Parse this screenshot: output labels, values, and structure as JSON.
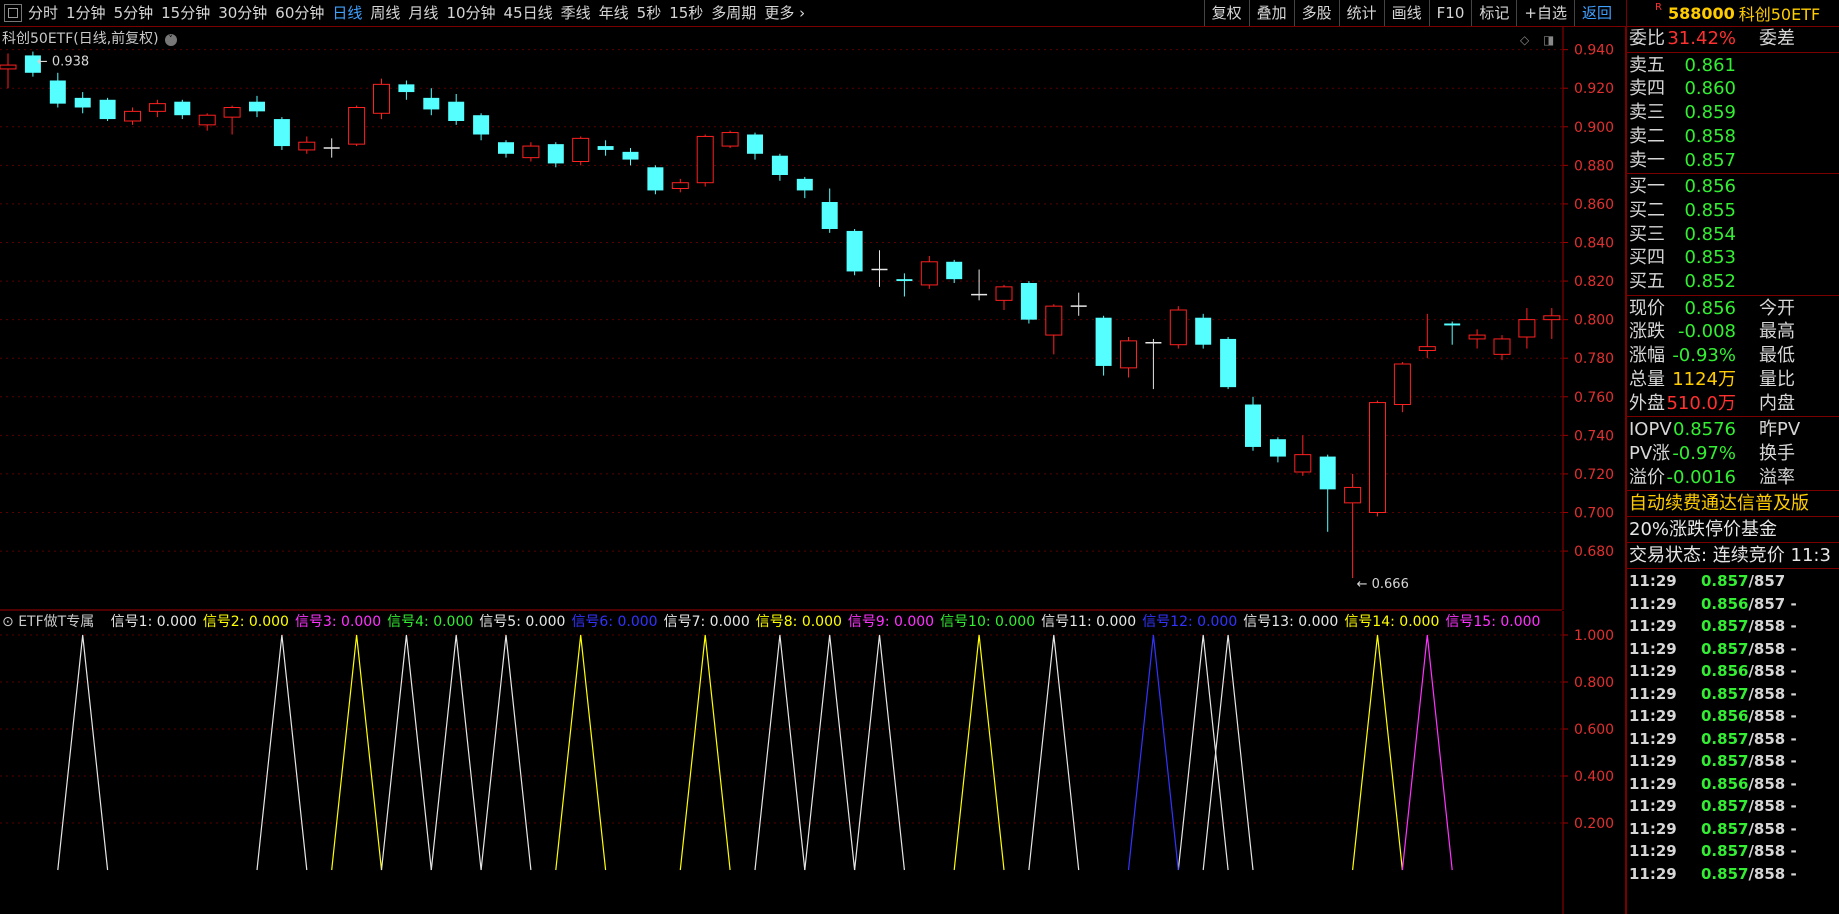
{
  "toolbar": {
    "periods": [
      "分时",
      "1分钟",
      "5分钟",
      "15分钟",
      "30分钟",
      "60分钟",
      "日线",
      "周线",
      "月线",
      "10分钟",
      "45日线",
      "季线",
      "年线",
      "5秒",
      "15秒",
      "多周期",
      "更多 ›"
    ],
    "active_period": "日线",
    "right_buttons": [
      "复权",
      "叠加",
      "多股",
      "统计",
      "画线",
      "F10",
      "标记",
      "+自选",
      "返回"
    ]
  },
  "stock": {
    "marker": "R",
    "code": "588000",
    "name": "科创50ETF"
  },
  "chart": {
    "title": "科创50ETF(日线,前复权)",
    "high_label": "0.938",
    "low_label": "0.666",
    "price_ticks": [
      "0.940",
      "0.920",
      "0.900",
      "0.880",
      "0.860",
      "0.840",
      "0.820",
      "0.800",
      "0.780",
      "0.760",
      "0.740",
      "0.720",
      "0.700",
      "0.680"
    ],
    "indicator_ticks": [
      "1.000",
      "0.800",
      "0.600",
      "0.400",
      "0.200"
    ]
  },
  "chart_data": {
    "type": "candlestick",
    "ylim": [
      0.665,
      0.945
    ],
    "candles": [
      [
        0.93,
        0.932,
        0.92,
        0.938
      ],
      [
        0.937,
        0.928,
        0.926,
        0.939
      ],
      [
        0.924,
        0.912,
        0.91,
        0.928
      ],
      [
        0.915,
        0.91,
        0.907,
        0.918
      ],
      [
        0.914,
        0.904,
        0.903,
        0.915
      ],
      [
        0.903,
        0.908,
        0.901,
        0.91
      ],
      [
        0.908,
        0.912,
        0.905,
        0.914
      ],
      [
        0.913,
        0.906,
        0.904,
        0.914
      ],
      [
        0.901,
        0.906,
        0.898,
        0.907
      ],
      [
        0.905,
        0.91,
        0.896,
        0.911
      ],
      [
        0.913,
        0.908,
        0.905,
        0.916
      ],
      [
        0.904,
        0.89,
        0.888,
        0.905
      ],
      [
        0.888,
        0.892,
        0.886,
        0.895
      ],
      [
        0.889,
        0.889,
        0.884,
        0.894
      ],
      [
        0.891,
        0.91,
        0.89,
        0.911
      ],
      [
        0.907,
        0.922,
        0.904,
        0.925
      ],
      [
        0.922,
        0.918,
        0.914,
        0.924
      ],
      [
        0.915,
        0.909,
        0.906,
        0.92
      ],
      [
        0.913,
        0.903,
        0.901,
        0.917
      ],
      [
        0.906,
        0.896,
        0.893,
        0.907
      ],
      [
        0.892,
        0.886,
        0.884,
        0.893
      ],
      [
        0.884,
        0.89,
        0.882,
        0.892
      ],
      [
        0.891,
        0.881,
        0.879,
        0.892
      ],
      [
        0.882,
        0.894,
        0.88,
        0.895
      ],
      [
        0.89,
        0.888,
        0.885,
        0.893
      ],
      [
        0.887,
        0.883,
        0.88,
        0.889
      ],
      [
        0.879,
        0.867,
        0.865,
        0.88
      ],
      [
        0.868,
        0.871,
        0.866,
        0.873
      ],
      [
        0.871,
        0.895,
        0.869,
        0.896
      ],
      [
        0.89,
        0.897,
        0.889,
        0.898
      ],
      [
        0.896,
        0.886,
        0.883,
        0.897
      ],
      [
        0.885,
        0.875,
        0.872,
        0.886
      ],
      [
        0.873,
        0.867,
        0.863,
        0.874
      ],
      [
        0.861,
        0.847,
        0.845,
        0.868
      ],
      [
        0.846,
        0.825,
        0.823,
        0.847
      ],
      [
        0.826,
        0.826,
        0.817,
        0.836
      ],
      [
        0.821,
        0.82,
        0.812,
        0.824
      ],
      [
        0.818,
        0.83,
        0.816,
        0.833
      ],
      [
        0.83,
        0.821,
        0.819,
        0.831
      ],
      [
        0.813,
        0.813,
        0.81,
        0.826
      ],
      [
        0.81,
        0.817,
        0.805,
        0.818
      ],
      [
        0.819,
        0.8,
        0.798,
        0.82
      ],
      [
        0.792,
        0.807,
        0.782,
        0.808
      ],
      [
        0.807,
        0.807,
        0.802,
        0.814
      ],
      [
        0.801,
        0.776,
        0.771,
        0.802
      ],
      [
        0.775,
        0.789,
        0.77,
        0.791
      ],
      [
        0.788,
        0.788,
        0.764,
        0.79
      ],
      [
        0.787,
        0.805,
        0.785,
        0.807
      ],
      [
        0.801,
        0.787,
        0.785,
        0.803
      ],
      [
        0.79,
        0.765,
        0.764,
        0.791
      ],
      [
        0.756,
        0.734,
        0.732,
        0.76
      ],
      [
        0.738,
        0.729,
        0.726,
        0.739
      ],
      [
        0.721,
        0.73,
        0.719,
        0.74
      ],
      [
        0.729,
        0.712,
        0.69,
        0.73
      ],
      [
        0.705,
        0.713,
        0.666,
        0.72
      ],
      [
        0.7,
        0.757,
        0.698,
        0.758
      ],
      [
        0.756,
        0.777,
        0.752,
        0.778
      ],
      [
        0.784,
        0.786,
        0.78,
        0.803
      ],
      [
        0.798,
        0.797,
        0.787,
        0.799
      ],
      [
        0.79,
        0.792,
        0.785,
        0.795
      ],
      [
        0.782,
        0.79,
        0.779,
        0.792
      ],
      [
        0.791,
        0.8,
        0.785,
        0.806
      ],
      [
        0.8,
        0.802,
        0.79,
        0.806
      ]
    ],
    "signals": [
      {
        "name": "信号1",
        "value": "0.000",
        "color": "#e6e6e6",
        "peaks": [
          3
        ]
      },
      {
        "name": "信号2",
        "value": "0.000",
        "color": "#ffff00",
        "peaks": [
          14
        ]
      },
      {
        "name": "信号3",
        "value": "0.000",
        "color": "#ff33ff",
        "peaks": []
      },
      {
        "name": "信号4",
        "value": "0.000",
        "color": "#33ee33",
        "peaks": []
      },
      {
        "name": "信号5",
        "value": "0.000",
        "color": "#e6e6e6",
        "peaks": [
          11,
          16,
          18,
          20
        ]
      },
      {
        "name": "信号6",
        "value": "0.000",
        "color": "#3333ff",
        "peaks": []
      },
      {
        "name": "信号7",
        "value": "0.000",
        "color": "#e6e6e6",
        "peaks": [
          31,
          33,
          35
        ]
      },
      {
        "name": "信号8",
        "value": "0.000",
        "color": "#ffff00",
        "peaks": [
          23,
          28,
          39
        ]
      },
      {
        "name": "信号9",
        "value": "0.000",
        "color": "#ff33ff",
        "peaks": []
      },
      {
        "name": "信号10",
        "value": "0.000",
        "color": "#33ee33",
        "peaks": []
      },
      {
        "name": "信号11",
        "value": "0.000",
        "color": "#e6e6e6",
        "peaks": [
          42,
          48,
          49
        ]
      },
      {
        "name": "信号12",
        "value": "0.000",
        "color": "#3333ff",
        "peaks": [
          46
        ]
      },
      {
        "name": "信号13",
        "value": "0.000",
        "color": "#e6e6e6",
        "peaks": []
      },
      {
        "name": "信号14",
        "value": "0.000",
        "color": "#ffff00",
        "peaks": [
          55
        ]
      },
      {
        "name": "信号15",
        "value": "0.000",
        "color": "#ff33ff",
        "peaks": [
          57
        ]
      }
    ]
  },
  "indicator": {
    "name": "ETF做T专属"
  },
  "quote": {
    "webi": {
      "label": "委比",
      "value": "31.42%",
      "label2": "委差"
    },
    "asks": [
      {
        "label": "卖五",
        "price": "0.861"
      },
      {
        "label": "卖四",
        "price": "0.860"
      },
      {
        "label": "卖三",
        "price": "0.859"
      },
      {
        "label": "卖二",
        "price": "0.858"
      },
      {
        "label": "卖一",
        "price": "0.857"
      }
    ],
    "bids": [
      {
        "label": "买一",
        "price": "0.856"
      },
      {
        "label": "买二",
        "price": "0.855"
      },
      {
        "label": "买三",
        "price": "0.854"
      },
      {
        "label": "买四",
        "price": "0.853"
      },
      {
        "label": "买五",
        "price": "0.852"
      }
    ],
    "stats": [
      {
        "label": "现价",
        "value": "0.856",
        "label2": "今开",
        "color": "#33ee33"
      },
      {
        "label": "涨跌",
        "value": "-0.008",
        "label2": "最高",
        "color": "#33ee33"
      },
      {
        "label": "涨幅",
        "value": "-0.93%",
        "label2": "最低",
        "color": "#33ee33"
      },
      {
        "label": "总量",
        "value": "1124万",
        "label2": "量比",
        "color": "#ffcc00"
      },
      {
        "label": "外盘",
        "value": "510.0万",
        "label2": "内盘",
        "color": "#ff3030"
      }
    ],
    "iopv": [
      {
        "label": "IOPV",
        "value": "0.8576",
        "label2": "昨PV",
        "color": "#33ee33"
      },
      {
        "label": "PV涨",
        "value": "-0.97%",
        "label2": "换手",
        "color": "#33ee33"
      },
      {
        "label": "溢价",
        "value": "-0.0016",
        "label2": "溢率",
        "color": "#33ee33"
      }
    ],
    "promo": "自动续费通达信普及版",
    "limit_text": "20%涨跌停价基金",
    "trade_status": "交易状态: 连续竞价 11:3",
    "ticks": [
      {
        "time": "11:29",
        "price": "0.857",
        "rest": "/857"
      },
      {
        "time": "11:29",
        "price": "0.856",
        "rest": "/857 -"
      },
      {
        "time": "11:29",
        "price": "0.857",
        "rest": "/858 -"
      },
      {
        "time": "11:29",
        "price": "0.857",
        "rest": "/858 -"
      },
      {
        "time": "11:29",
        "price": "0.856",
        "rest": "/858 -"
      },
      {
        "time": "11:29",
        "price": "0.857",
        "rest": "/858 -"
      },
      {
        "time": "11:29",
        "price": "0.856",
        "rest": "/858 -"
      },
      {
        "time": "11:29",
        "price": "0.857",
        "rest": "/858 -"
      },
      {
        "time": "11:29",
        "price": "0.857",
        "rest": "/858 -"
      },
      {
        "time": "11:29",
        "price": "0.856",
        "rest": "/858 -"
      },
      {
        "time": "11:29",
        "price": "0.857",
        "rest": "/858 -"
      },
      {
        "time": "11:29",
        "price": "0.857",
        "rest": "/858 -"
      },
      {
        "time": "11:29",
        "price": "0.857",
        "rest": "/858 -"
      },
      {
        "time": "11:29",
        "price": "0.857",
        "rest": "/858 -"
      }
    ]
  }
}
